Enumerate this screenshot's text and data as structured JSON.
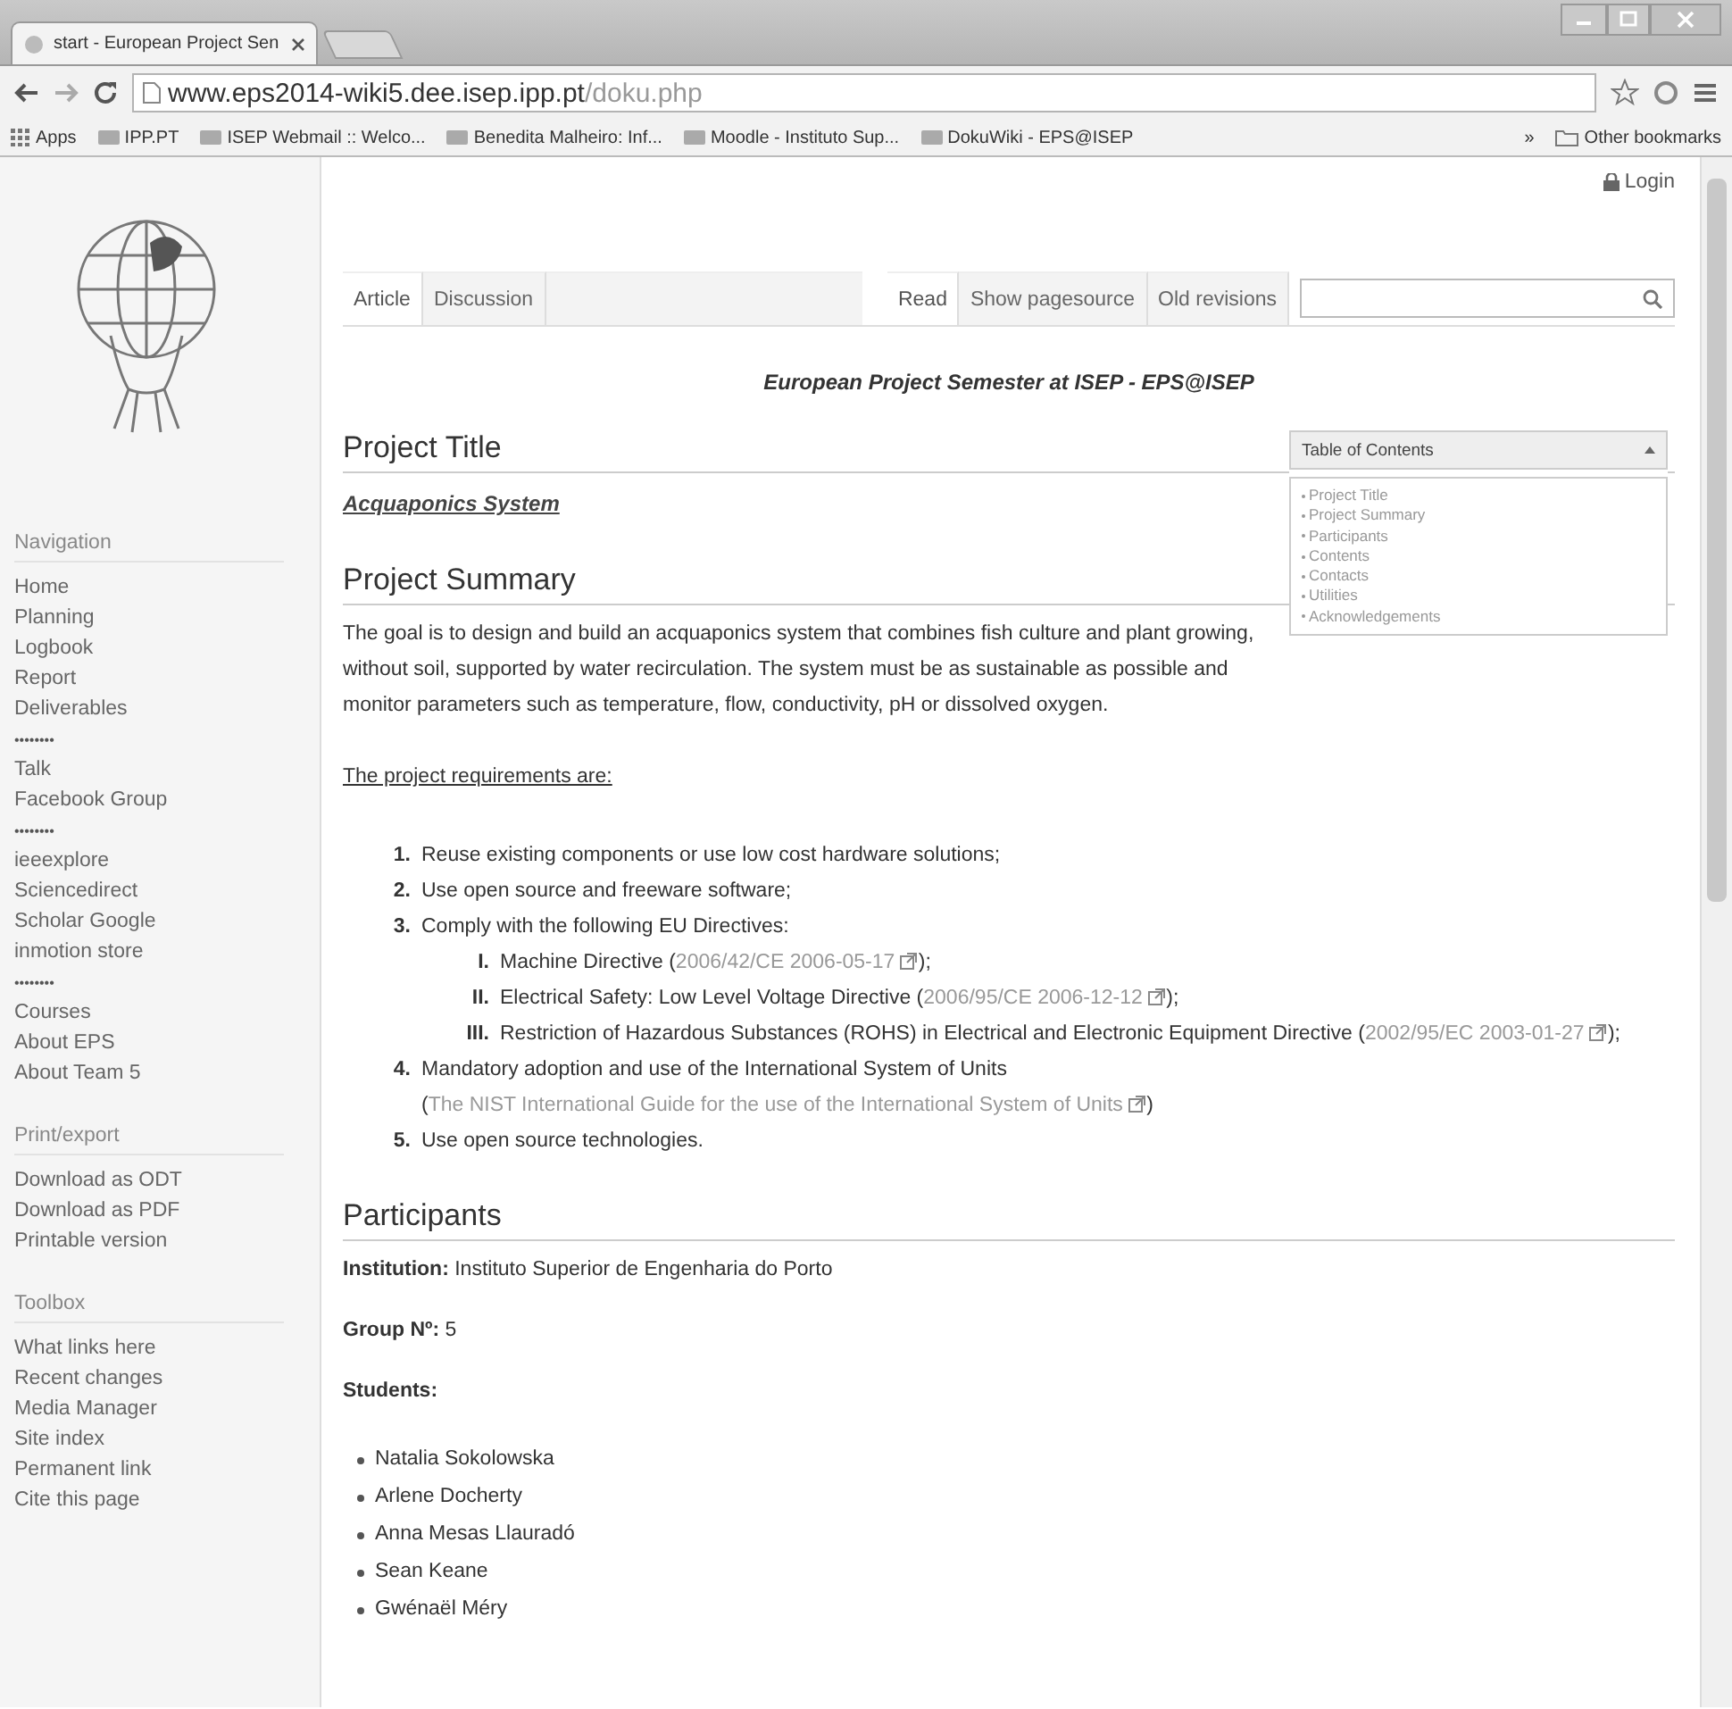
{
  "browser": {
    "tab_title": "start - European Project Sen",
    "url_host": "www.eps2014-wiki5.dee.isep.ipp.pt",
    "url_path": "/doku.php",
    "bookmarks": [
      {
        "label": "Apps",
        "kind": "apps"
      },
      {
        "label": "IPP.PT",
        "kind": "site"
      },
      {
        "label": "ISEP Webmail :: Welco...",
        "kind": "site"
      },
      {
        "label": "Benedita Malheiro: Inf...",
        "kind": "site"
      },
      {
        "label": "Moodle - Instituto Sup...",
        "kind": "site"
      },
      {
        "label": "DokuWiki - EPS@ISEP",
        "kind": "site"
      }
    ],
    "overflow": "»",
    "other_bookmarks": "Other bookmarks"
  },
  "login": "Login",
  "sidebar": [
    {
      "heading": "Navigation",
      "items": [
        {
          "kind": "link",
          "label": "Home"
        },
        {
          "kind": "link",
          "label": "Planning"
        },
        {
          "kind": "link",
          "label": "Logbook"
        },
        {
          "kind": "link",
          "label": "Report"
        },
        {
          "kind": "link",
          "label": "Deliverables"
        },
        {
          "kind": "separator",
          "label": "••••••••"
        },
        {
          "kind": "link",
          "label": "Talk"
        },
        {
          "kind": "link",
          "label": "Facebook Group"
        },
        {
          "kind": "separator",
          "label": "••••••••"
        },
        {
          "kind": "link",
          "label": "ieeexplore"
        },
        {
          "kind": "link",
          "label": "Sciencedirect"
        },
        {
          "kind": "link",
          "label": "Scholar Google"
        },
        {
          "kind": "link",
          "label": "inmotion store"
        },
        {
          "kind": "separator",
          "label": "••••••••"
        },
        {
          "kind": "link",
          "label": "Courses"
        },
        {
          "kind": "link",
          "label": "About EPS"
        },
        {
          "kind": "link",
          "label": "About Team 5"
        }
      ]
    },
    {
      "heading": "Print/export",
      "items": [
        {
          "kind": "link",
          "label": "Download as ODT"
        },
        {
          "kind": "link",
          "label": "Download as PDF"
        },
        {
          "kind": "link",
          "label": "Printable version"
        }
      ]
    },
    {
      "heading": "Toolbox",
      "items": [
        {
          "kind": "link",
          "label": "What links here"
        },
        {
          "kind": "link",
          "label": "Recent changes"
        },
        {
          "kind": "link",
          "label": "Media Manager"
        },
        {
          "kind": "link",
          "label": "Site index"
        },
        {
          "kind": "link",
          "label": "Permanent link"
        },
        {
          "kind": "link",
          "label": "Cite this page"
        }
      ]
    }
  ],
  "page_tabs": [
    {
      "label": "Article",
      "selected": true
    },
    {
      "label": "Discussion",
      "selected": false
    }
  ],
  "view_tabs": [
    {
      "label": "Read",
      "selected": true
    },
    {
      "label": "Show pagesource",
      "selected": false
    },
    {
      "label": "Old revisions",
      "selected": false
    }
  ],
  "banner": "European Project Semester at ISEP - EPS@ISEP",
  "toc": {
    "title": "Table of Contents",
    "expanded": true,
    "items": [
      "Project Title",
      "Project Summary",
      "Participants",
      "Contents",
      "Contacts",
      "Utilities",
      "Acknowledgements"
    ]
  },
  "project_title": {
    "heading": "Project Title",
    "link": "Acquaponics System"
  },
  "summary": {
    "heading": "Project Summary",
    "paragraph": "The goal is to design and build an acquaponics system that combines fish culture and plant growing, without soil, supported by water recirculation. The system must be as sustainable as possible and monitor parameters such as temperature, flow, conductivity, pH or dissolved oxygen.",
    "requirements_intro": "The project requirements are:",
    "requirements": [
      {
        "number": "1.",
        "text": "Reuse existing components or use low cost hardware solutions;"
      },
      {
        "number": "2.",
        "text": "Use open source and freeware software;"
      },
      {
        "number": "3.",
        "text": "Comply with the following EU Directives:",
        "sub": [
          {
            "number": "I.",
            "text": "Machine Directive (",
            "link": "2006/42/CE 2006-05-17",
            "after": ");"
          },
          {
            "number": "II.",
            "text": "Electrical Safety: Low Level Voltage Directive (",
            "link": "2006/95/CE 2006-12-12",
            "after": ");"
          },
          {
            "number": "III.",
            "text": "Restriction of Hazardous Substances (ROHS) in Electrical and Electronic Equipment Directive (",
            "link": "2002/95/EC 2003-01-27",
            "after": ");"
          }
        ]
      },
      {
        "number": "4.",
        "text": "Mandatory adoption and use of the International System of Units (",
        "link": "The NIST International Guide for the use of the International System of Units",
        "after": ")"
      },
      {
        "number": "5.",
        "text": "Use open source technologies."
      }
    ]
  },
  "participants": {
    "heading": "Participants",
    "fields": [
      {
        "label": "Institution:",
        "value": "Instituto Superior de Engenharia do Porto"
      },
      {
        "label": "Group Nº:",
        "value": "5"
      }
    ],
    "students_label": "Students:",
    "students": [
      "Natalia Sokolowska",
      "Arlene Docherty",
      "Anna Mesas Llauradó",
      "Sean Keane",
      "Gwénaël Méry"
    ]
  }
}
